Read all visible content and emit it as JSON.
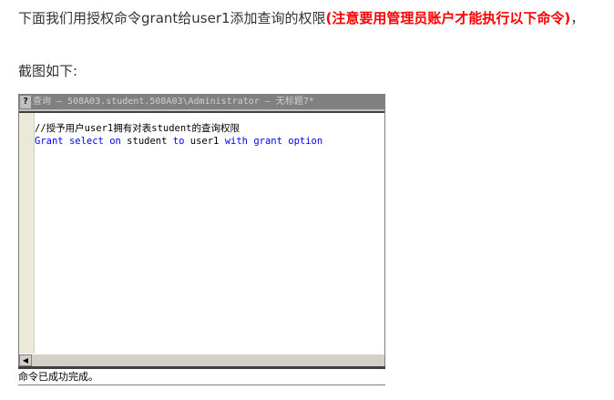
{
  "intro": {
    "normal": "下面我们用授权命令grant给user1添加查询的权限",
    "warning": "(注意要用管理员账户才能执行以下命令)",
    "tail": "，"
  },
  "caption": "截图如下:",
  "screenshot": {
    "window_title": "查询 — 508A03.student.508A03\\Administrator — 无标题7*",
    "code_lines": [
      {
        "tokens": [
          {
            "text": "//授予用户user1拥有对表student的查询权限",
            "kind": "comment"
          }
        ]
      },
      {
        "tokens": [
          {
            "text": "Grant",
            "kind": "keyword"
          },
          {
            "text": " ",
            "kind": "plain"
          },
          {
            "text": "select",
            "kind": "keyword"
          },
          {
            "text": " ",
            "kind": "plain"
          },
          {
            "text": "on",
            "kind": "keyword"
          },
          {
            "text": " student ",
            "kind": "plain"
          },
          {
            "text": "to",
            "kind": "keyword"
          },
          {
            "text": " user1 ",
            "kind": "plain"
          },
          {
            "text": "with",
            "kind": "keyword"
          },
          {
            "text": " ",
            "kind": "plain"
          },
          {
            "text": "grant",
            "kind": "keyword"
          },
          {
            "text": " ",
            "kind": "plain"
          },
          {
            "text": "option",
            "kind": "keyword"
          }
        ]
      }
    ],
    "status": "命令已成功完成。"
  }
}
